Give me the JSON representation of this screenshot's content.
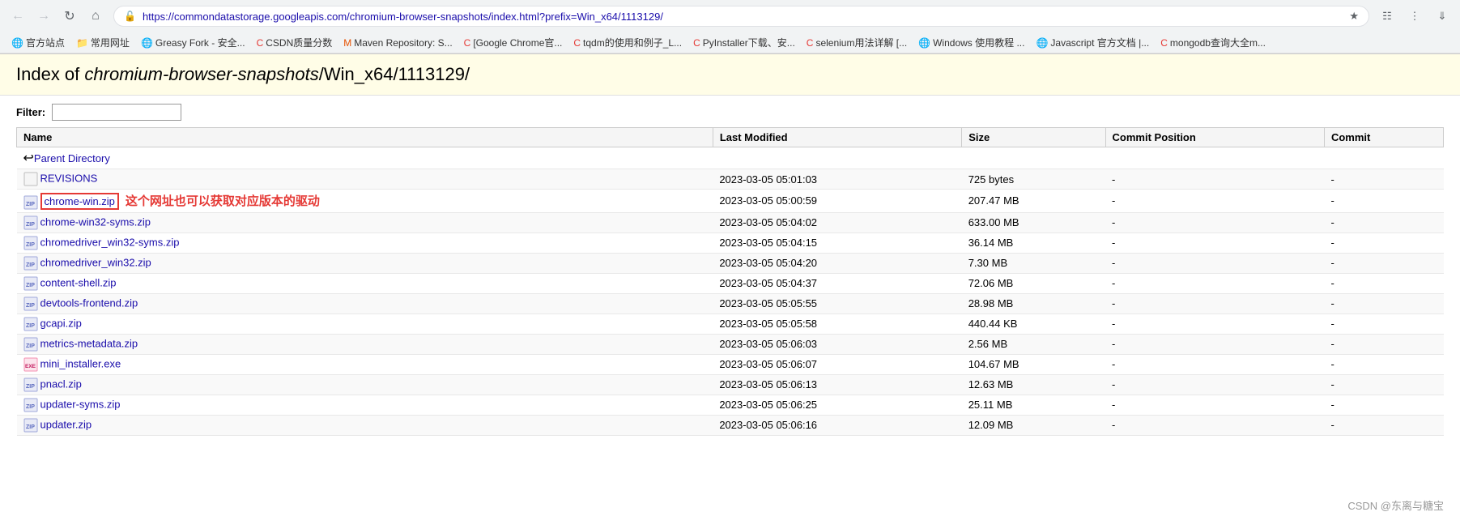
{
  "browser": {
    "url": "https://commondatastorage.googleapis.com/chromium-browser-snapshots/index.html?prefix=Win_x64/1113129/",
    "bookmarks": [
      {
        "label": "官方站点"
      },
      {
        "label": "常用网址"
      },
      {
        "label": "Greasy Fork - 安全..."
      },
      {
        "label": "CSDN质量分数"
      },
      {
        "label": "Maven Repository: S..."
      },
      {
        "label": "[Google Chrome官..."
      },
      {
        "label": "tqdm的使用和例子_L..."
      },
      {
        "label": "PyInstaller下载、安..."
      },
      {
        "label": "selenium用法详解 [..."
      },
      {
        "label": "Windows 使用教程 ..."
      },
      {
        "label": "Javascript 官方文档 |..."
      },
      {
        "label": "mongodb查询大全m..."
      }
    ]
  },
  "page": {
    "title_prefix": "Index of ",
    "title_path_italic": "chromium-browser-snapshots",
    "title_path_rest": "/Win_x64/1113129/",
    "filter_label": "Filter:",
    "filter_placeholder": "",
    "columns": [
      "Name",
      "Last Modified",
      "Size",
      "Commit Position",
      "Commit"
    ],
    "files": [
      {
        "name": "Parent Directory",
        "href": "#",
        "modified": "",
        "size": "",
        "commit_pos": "",
        "commit": "",
        "type": "parent",
        "icon": "↩"
      },
      {
        "name": "REVISIONS",
        "href": "#",
        "modified": "2023-03-05 05:01:03",
        "size": "725 bytes",
        "commit_pos": "-",
        "commit": "-",
        "type": "file",
        "icon": "📄"
      },
      {
        "name": "chrome-win.zip",
        "href": "#",
        "modified": "2023-03-05 05:00:59",
        "size": "207.47 MB",
        "commit_pos": "-",
        "commit": "-",
        "type": "zip",
        "icon": "📦",
        "highlight": true,
        "annotation": "这个网址也可以获取对应版本的驱动"
      },
      {
        "name": "chrome-win32-syms.zip",
        "href": "#",
        "modified": "2023-03-05 05:04:02",
        "size": "633.00 MB",
        "commit_pos": "-",
        "commit": "-",
        "type": "zip",
        "icon": "📦"
      },
      {
        "name": "chromedriver_win32-syms.zip",
        "href": "#",
        "modified": "2023-03-05 05:04:15",
        "size": "36.14 MB",
        "commit_pos": "-",
        "commit": "-",
        "type": "zip",
        "icon": "📦"
      },
      {
        "name": "chromedriver_win32.zip",
        "href": "#",
        "modified": "2023-03-05 05:04:20",
        "size": "7.30 MB",
        "commit_pos": "-",
        "commit": "-",
        "type": "zip",
        "icon": "📦"
      },
      {
        "name": "content-shell.zip",
        "href": "#",
        "modified": "2023-03-05 05:04:37",
        "size": "72.06 MB",
        "commit_pos": "-",
        "commit": "-",
        "type": "zip",
        "icon": "📦"
      },
      {
        "name": "devtools-frontend.zip",
        "href": "#",
        "modified": "2023-03-05 05:05:55",
        "size": "28.98 MB",
        "commit_pos": "-",
        "commit": "-",
        "type": "zip",
        "icon": "📦"
      },
      {
        "name": "gcapi.zip",
        "href": "#",
        "modified": "2023-03-05 05:05:58",
        "size": "440.44 KB",
        "commit_pos": "-",
        "commit": "-",
        "type": "zip",
        "icon": "📦"
      },
      {
        "name": "metrics-metadata.zip",
        "href": "#",
        "modified": "2023-03-05 05:06:03",
        "size": "2.56 MB",
        "commit_pos": "-",
        "commit": "-",
        "type": "zip",
        "icon": "📦"
      },
      {
        "name": "mini_installer.exe",
        "href": "#",
        "modified": "2023-03-05 05:06:07",
        "size": "104.67 MB",
        "commit_pos": "-",
        "commit": "-",
        "type": "exe",
        "icon": "⚙️"
      },
      {
        "name": "pnacl.zip",
        "href": "#",
        "modified": "2023-03-05 05:06:13",
        "size": "12.63 MB",
        "commit_pos": "-",
        "commit": "-",
        "type": "zip",
        "icon": "📦"
      },
      {
        "name": "updater-syms.zip",
        "href": "#",
        "modified": "2023-03-05 05:06:25",
        "size": "25.11 MB",
        "commit_pos": "-",
        "commit": "-",
        "type": "zip",
        "icon": "📦"
      },
      {
        "name": "updater.zip",
        "href": "#",
        "modified": "2023-03-05 05:06:16",
        "size": "12.09 MB",
        "commit_pos": "-",
        "commit": "-",
        "type": "zip",
        "icon": "📦"
      }
    ]
  },
  "watermark": "CSDN @东离与糖宝"
}
